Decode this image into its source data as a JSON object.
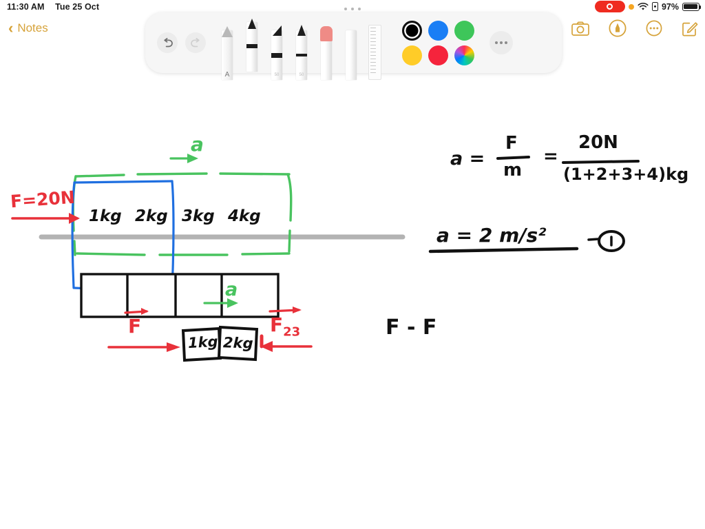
{
  "status_bar": {
    "time": "11:30 AM",
    "date": "Tue 25 Oct",
    "battery_percent": "97%",
    "recording_icon": "record-indicator",
    "orange_dot_icon": "mic-in-use-dot",
    "wifi_icon": "wifi-icon",
    "lock_icon": "rotation-lock-icon",
    "battery_icon": "battery-icon"
  },
  "nav": {
    "back_label": "Notes",
    "back_icon": "chevron-left-icon",
    "accent_color": "#d6a33a"
  },
  "top_right_actions": [
    {
      "name": "camera-icon",
      "label": "Camera"
    },
    {
      "name": "markup-icon",
      "label": "Markup"
    },
    {
      "name": "more-icon",
      "label": "More"
    },
    {
      "name": "compose-icon",
      "label": "New Note"
    }
  ],
  "markup_toolbar": {
    "grabber_icon": "drag-handle-icon",
    "undo": {
      "label": "Undo",
      "icon": "undo-arrow-icon",
      "enabled": true
    },
    "redo": {
      "label": "Redo",
      "icon": "redo-arrow-icon",
      "enabled": false
    },
    "tools": [
      {
        "name": "text-pen-tool",
        "label": "A",
        "selected": false
      },
      {
        "name": "pen-tool",
        "label": "",
        "selected": true
      },
      {
        "name": "highlighter-tool",
        "label": "50",
        "selected": false
      },
      {
        "name": "marker-tool",
        "label": "50",
        "selected": false
      },
      {
        "name": "eraser-tool",
        "label": "",
        "selected": false
      },
      {
        "name": "lasso-tool",
        "label": "",
        "selected": false
      },
      {
        "name": "ruler-tool",
        "label": "",
        "selected": false
      }
    ],
    "colors": [
      {
        "name": "color-black",
        "hex": "#000000",
        "selected": true
      },
      {
        "name": "color-blue",
        "hex": "#1a7ef5",
        "selected": false
      },
      {
        "name": "color-green",
        "hex": "#3ec65a",
        "selected": false
      },
      {
        "name": "color-yellow",
        "hex": "#ffcc28",
        "selected": false
      },
      {
        "name": "color-red",
        "hex": "#f5243c",
        "selected": false
      },
      {
        "name": "color-rainbow",
        "hex": "rainbow",
        "selected": false
      }
    ],
    "more_label": "More options",
    "more_icon": "ellipsis-icon"
  },
  "note": {
    "ink_colors": {
      "black": "#111111",
      "red": "#e8313a",
      "green": "#49c35f",
      "blue": "#1f6fe0",
      "ground": "#b3b3b3"
    },
    "diagram1": {
      "force_label": "F=20N",
      "accel_label": "a",
      "blocks": [
        {
          "mass": "1kg"
        },
        {
          "mass": "2kg"
        },
        {
          "mass": "3kg"
        },
        {
          "mass": "4kg"
        }
      ]
    },
    "equations": {
      "line1_lhs": "a =",
      "line1_frac_num": "F",
      "line1_frac_den": "m",
      "line1_eq": "=",
      "line1_frac2_num": "20N",
      "line1_frac2_den": "(1+2+3+4)kg",
      "line2": "a = 2 m/s²",
      "line2_tag": "—①"
    },
    "diagram2": {
      "accel_label": "a",
      "force_left_label": "F",
      "force_right_label": "F",
      "force_right_sub": "23",
      "blocks": [
        {
          "mass": "1kg"
        },
        {
          "mass": "2kg"
        }
      ]
    },
    "partial_equation": "F - F"
  }
}
